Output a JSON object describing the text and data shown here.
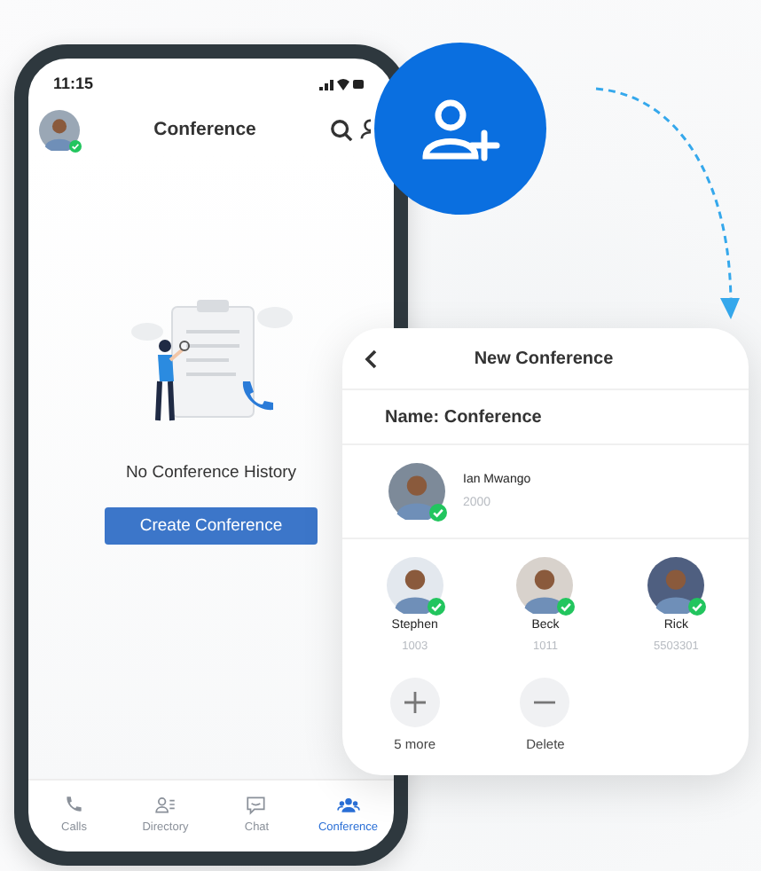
{
  "phone": {
    "status_bar": {
      "time": "11:15"
    },
    "header": {
      "title": "Conference"
    },
    "empty_state": {
      "message": "No Conference History",
      "button": "Create Conference"
    },
    "tab_bar": [
      {
        "label": "Calls",
        "selected": false
      },
      {
        "label": "Directory",
        "selected": false
      },
      {
        "label": "Chat",
        "selected": false
      },
      {
        "label": "Conference",
        "selected": true
      }
    ]
  },
  "new_conference": {
    "title": "New Conference",
    "name_field": "Name: Conference",
    "host": {
      "name": "Ian Mwango",
      "extension": "2000"
    },
    "participants": [
      {
        "name": "Stephen",
        "number": "1003"
      },
      {
        "name": "Beck",
        "number": "1011"
      },
      {
        "name": "Rick",
        "number": "5503301"
      }
    ],
    "actions": [
      {
        "kind": "add",
        "label": "5 more"
      },
      {
        "kind": "remove",
        "label": "Delete"
      }
    ]
  }
}
